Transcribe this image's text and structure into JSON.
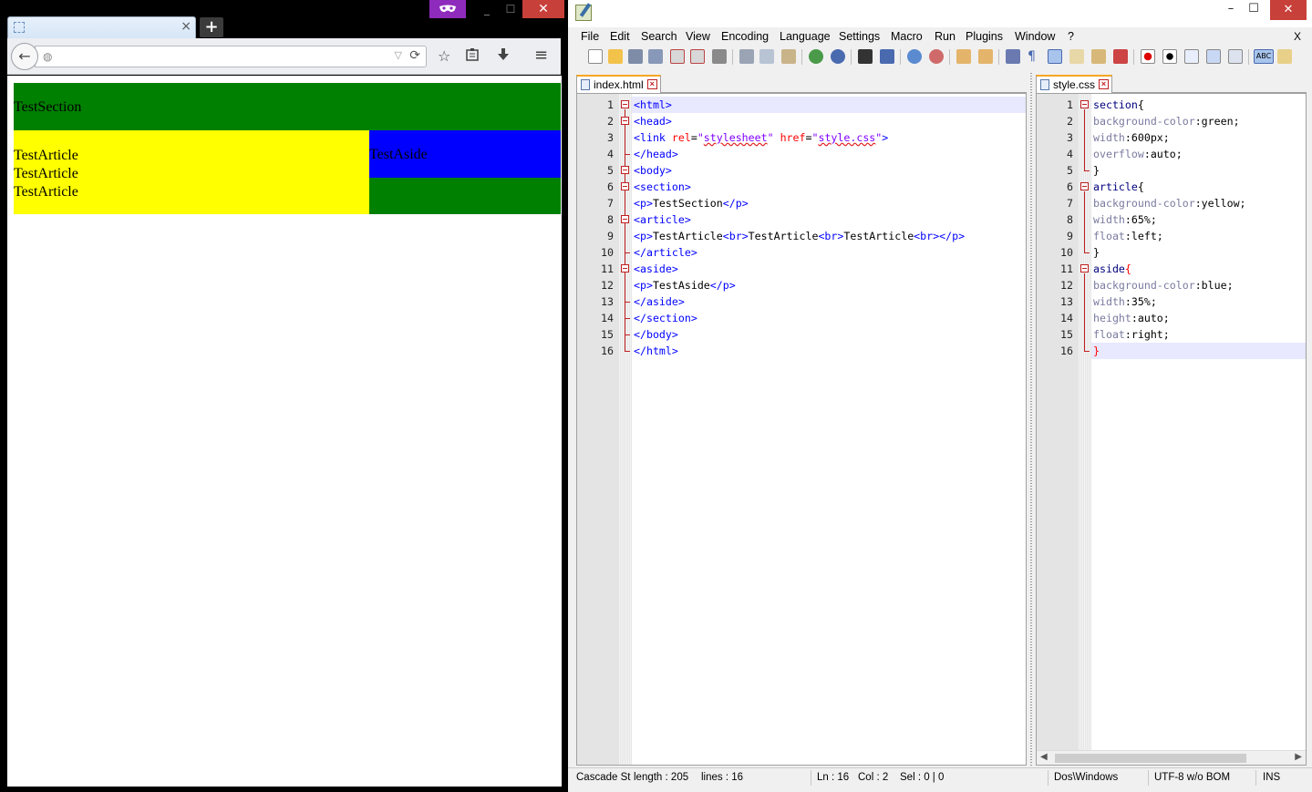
{
  "browser": {
    "tab_close": "×",
    "new_tab": "+",
    "private_icon": "mask-icon",
    "window": {
      "min": "_",
      "max": "☐",
      "close": "✕"
    },
    "back_glyph": "←",
    "url_value": "",
    "page": {
      "section_text": "TestSection",
      "article_lines": [
        "TestArticle",
        "TestArticle",
        "TestArticle"
      ],
      "aside_text": "TestAside",
      "colors": {
        "section": "green",
        "article": "yellow",
        "aside": "blue"
      }
    }
  },
  "npp": {
    "window": {
      "min": "–",
      "max": "☐",
      "close": "✕"
    },
    "menu": [
      "File",
      "Edit",
      "Search",
      "View",
      "Encoding",
      "Language",
      "Settings",
      "Macro",
      "Run",
      "Plugins",
      "Window",
      "?"
    ],
    "menu_close": "X",
    "tabs": {
      "left": "index.html",
      "right": "style.css",
      "close": "×"
    },
    "html_lines": [
      "<html>",
      "<head>",
      "<link rel=\"stylesheet\" href=\"style.css\">",
      "</head>",
      "<body>",
      "<section>",
      "<p>TestSection</p>",
      "<article>",
      "<p>TestArticle<br>TestArticle<br>TestArticle<br></p>",
      "</article>",
      "<aside>",
      "<p>TestAside</p>",
      "</aside>",
      "</section>",
      "</body>",
      "</html>"
    ],
    "css_lines": [
      "section{",
      "background-color:green;",
      "width:600px;",
      "overflow:auto;",
      "}",
      "article{",
      "background-color:yellow;",
      "width:65%;",
      "float:left;",
      "}",
      "aside{",
      "background-color:blue;",
      "width:35%;",
      "height:auto;",
      "float:right;",
      "}"
    ],
    "line_numbers": [
      "1",
      "2",
      "3",
      "4",
      "5",
      "6",
      "7",
      "8",
      "9",
      "10",
      "11",
      "12",
      "13",
      "14",
      "15",
      "16"
    ],
    "status": {
      "lang": "Cascade St",
      "length": "length : 205",
      "lines": "lines : 16",
      "ln": "Ln : 16",
      "col": "Col : 2",
      "sel": "Sel : 0 | 0",
      "eol": "Dos\\Windows",
      "encoding": "UTF-8 w/o BOM",
      "mode": "INS"
    }
  }
}
